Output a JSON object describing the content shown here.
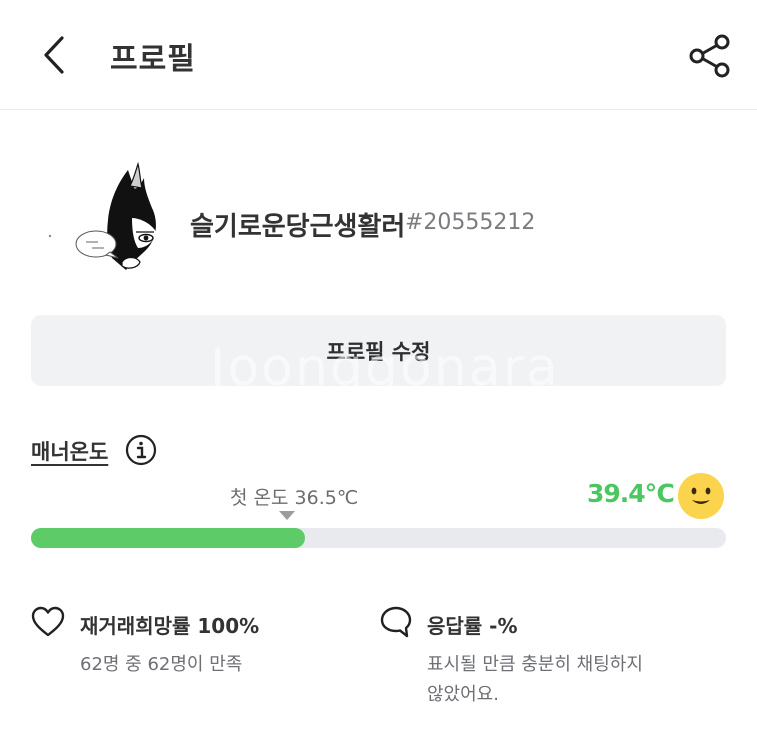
{
  "header": {
    "title": "프로필",
    "back_icon": "chevron-left-icon",
    "share_icon": "share-icon"
  },
  "profile": {
    "nickname": "슬기로운당근생활러",
    "user_id": "#20555212",
    "edit_button_label": "프로필 수정",
    "watermark": "Joonggonara"
  },
  "manner": {
    "label": "매너온도",
    "first_temp_label": "첫 온도 36.5℃",
    "current_temp": "39.4℃",
    "temp_fill_fraction": 0.394,
    "temp_color": "#4cc760",
    "face_icon": "smiley-face-icon"
  },
  "stats": {
    "rehire": {
      "icon": "heart-icon",
      "title": "재거래희망률 100%",
      "desc": "62명 중 62명이 만족"
    },
    "response": {
      "icon": "speech-bubble-icon",
      "title": "응답률 -%",
      "desc_line1": "표시될 만큼 충분히 채팅하지",
      "desc_line2": "않았어요."
    }
  }
}
